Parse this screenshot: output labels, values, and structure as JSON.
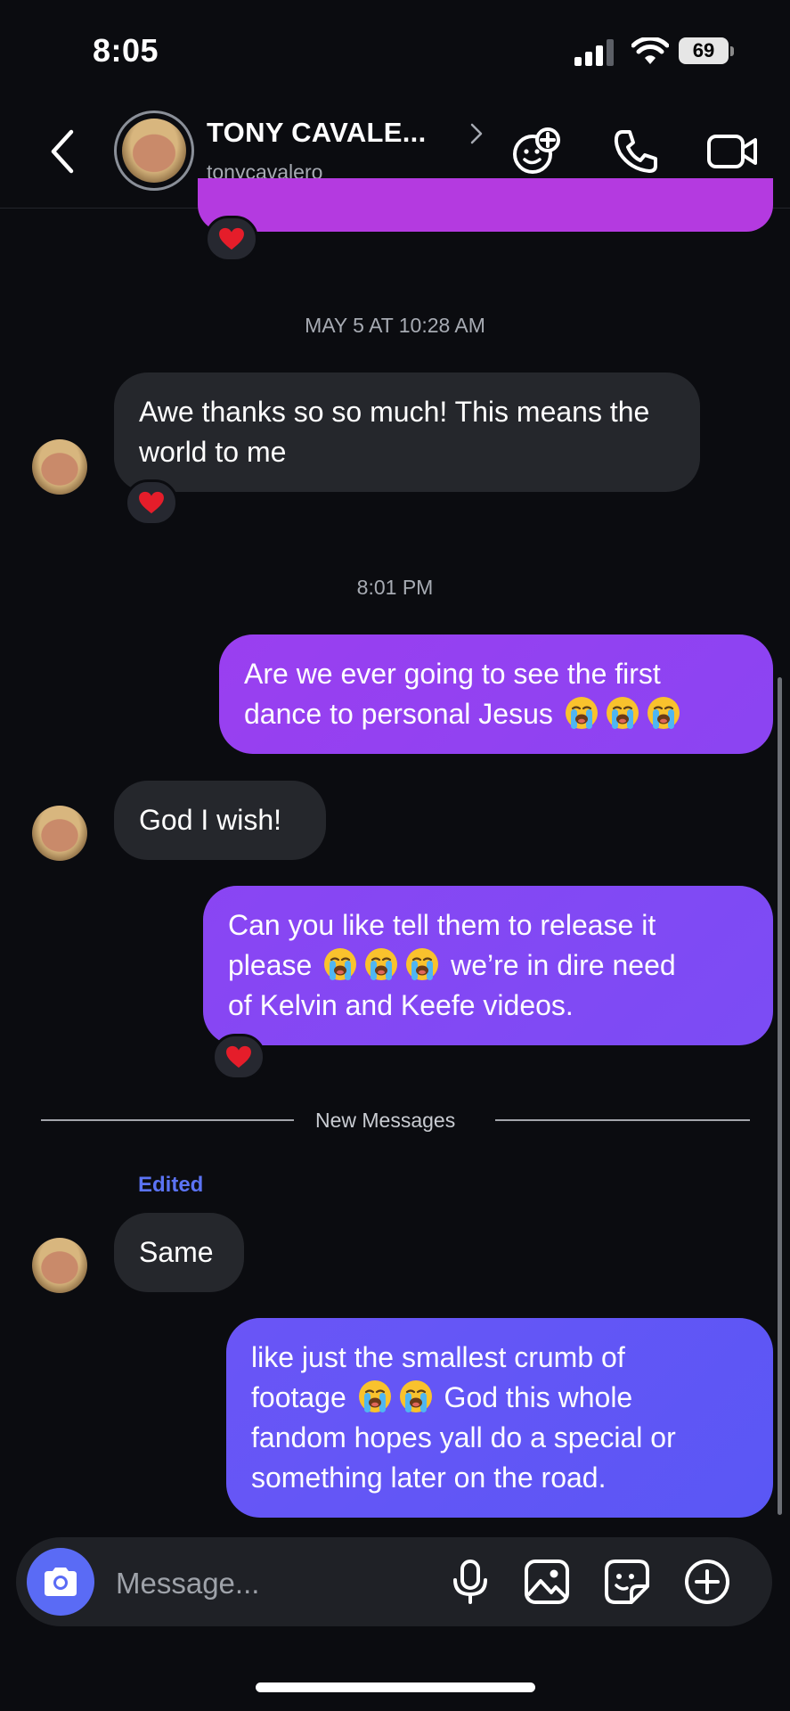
{
  "status_bar": {
    "time": "8:05",
    "battery": "69"
  },
  "header": {
    "name": "TONY CAVALE...",
    "username": "tonycavalero",
    "icons": [
      "back-chevron-icon",
      "effects-icon",
      "phone-icon",
      "video-camera-icon"
    ]
  },
  "thread": {
    "timestamp_1": "MAY 5 AT 10:28 AM",
    "msg_1": {
      "direction": "incoming",
      "text": "Awe thanks so so much! This means the world to me",
      "reaction": "heart"
    },
    "timestamp_2": "8:01 PM",
    "msg_2": {
      "direction": "outgoing",
      "line1": "Are we ever going to see the first",
      "line2": "dance to personal Jesus",
      "emoji": "loudly-crying-face x3"
    },
    "msg_3": {
      "direction": "incoming",
      "text": "God I wish!"
    },
    "msg_4": {
      "direction": "outgoing",
      "line1": "Can you like tell them to release it",
      "line2_pre": "please",
      "line2_post": "we’re in dire need",
      "line3": "of Kelvin and Keefe videos.",
      "reaction": "heart"
    },
    "new_messages_label": "New Messages",
    "edited_label": "Edited",
    "msg_5": {
      "direction": "incoming",
      "text": "Same"
    },
    "msg_6": {
      "direction": "outgoing",
      "line1": "like just the smallest crumb of",
      "line2_pre": "footage",
      "line2_post": "God this whole",
      "line3": "fandom hopes yall do a special or",
      "line4": "something later on the road."
    }
  },
  "composer": {
    "placeholder": "Message...",
    "icons": [
      "camera-icon",
      "microphone-icon",
      "gallery-icon",
      "sticker-icon",
      "add-icon"
    ]
  },
  "colors": {
    "background": "#0b0c10",
    "incoming_bubble": "#25272c",
    "outgoing_bubble_start": "#9a3ff0",
    "outgoing_bubble_end": "#5a57f5",
    "accent": "#5a6bf5",
    "edited": "#5b73f4",
    "heart": "#e51d2a"
  }
}
